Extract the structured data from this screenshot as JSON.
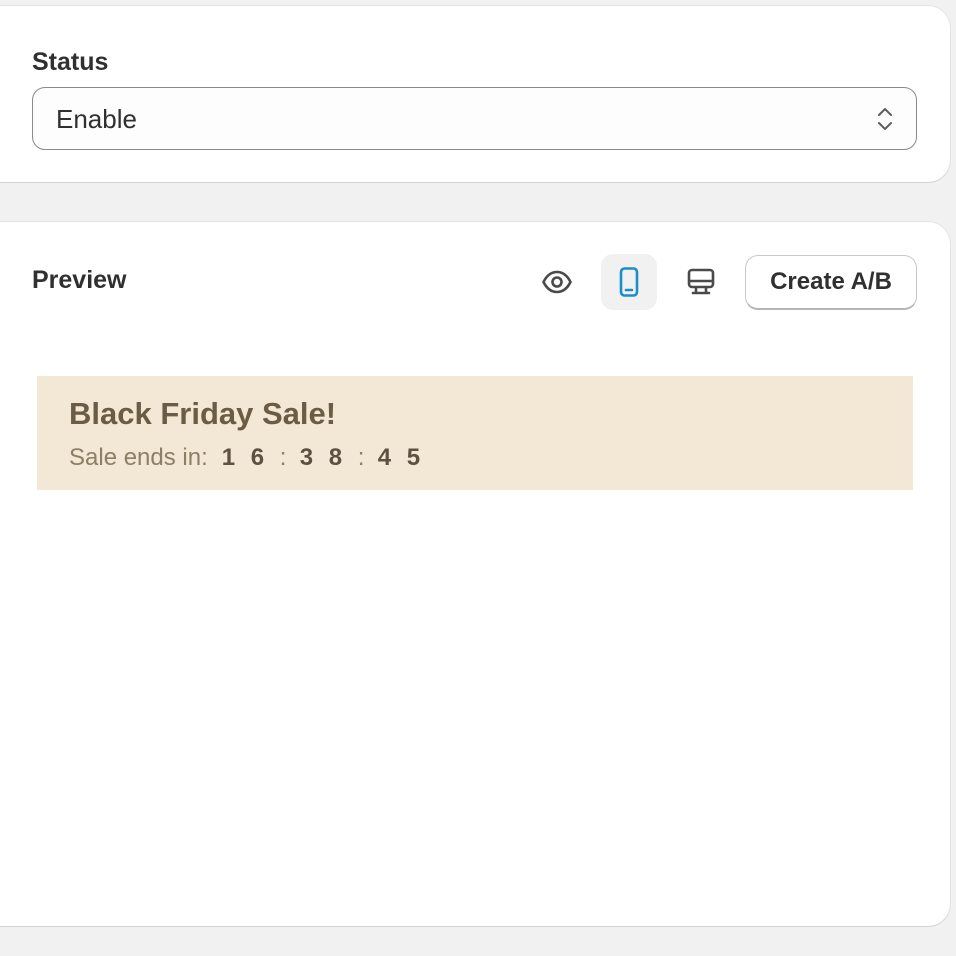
{
  "status": {
    "label": "Status",
    "select": {
      "value": "Enable",
      "icon": "select-chevrons-icon"
    }
  },
  "preview": {
    "title": "Preview",
    "controls": {
      "eye_icon": "eye-icon",
      "mobile_icon": "mobile-icon",
      "desktop_icon": "desktop-icon",
      "active": "mobile",
      "create_ab_label": "Create A/B"
    },
    "banner": {
      "title": "Black Friday Sale!",
      "subtitle": "Sale ends in:",
      "hours": [
        "1",
        "6"
      ],
      "minutes": [
        "3",
        "8"
      ],
      "seconds": [
        "4",
        "5"
      ],
      "separator": ":",
      "background_color": "#f3e7d5",
      "text_color": "#6a5c45"
    }
  },
  "colors": {
    "page_background": "#f1f1f1",
    "active_icon": "#1a8fc7",
    "icon": "#4a4a4a"
  }
}
